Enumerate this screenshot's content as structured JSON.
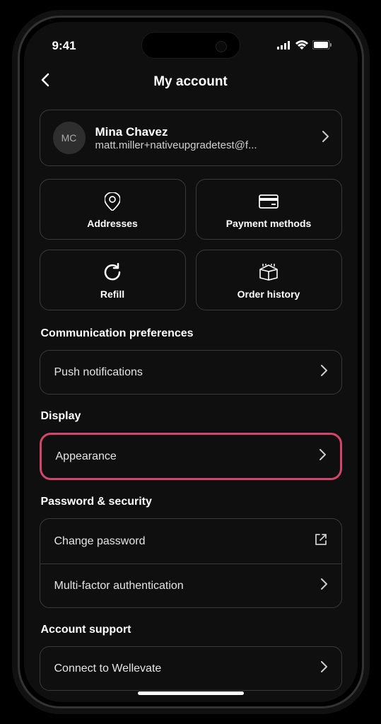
{
  "status": {
    "time": "9:41"
  },
  "header": {
    "title": "My account"
  },
  "profile": {
    "initials": "MC",
    "name": "Mina Chavez",
    "email": "matt.miller+nativeupgradetest@f..."
  },
  "tiles": {
    "addresses": "Addresses",
    "payment": "Payment methods",
    "refill": "Refill",
    "orders": "Order history"
  },
  "sections": {
    "communication": {
      "title": "Communication preferences",
      "items": {
        "push": "Push notifications"
      }
    },
    "display": {
      "title": "Display",
      "items": {
        "appearance": "Appearance"
      }
    },
    "security": {
      "title": "Password & security",
      "items": {
        "change_password": "Change password",
        "mfa": "Multi-factor authentication"
      }
    },
    "support": {
      "title": "Account support",
      "items": {
        "wellevate": "Connect to Wellevate"
      }
    }
  }
}
